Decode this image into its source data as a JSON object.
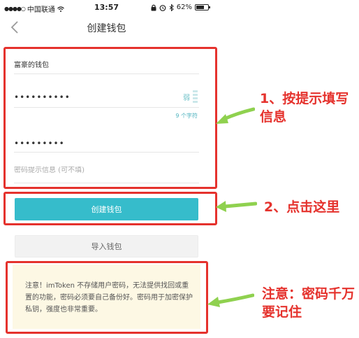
{
  "status_bar": {
    "carrier": "中国联通",
    "time": "13:57",
    "battery": "62%"
  },
  "nav": {
    "title": "创建钱包"
  },
  "form": {
    "wallet_name_value": "富豪的钱包",
    "password_value": "••••••••••",
    "strength_label": "弱",
    "char_count": "9 个字符",
    "confirm_value": "•••••••••",
    "hint_placeholder": "密码提示信息 (可不填)"
  },
  "buttons": {
    "create": "创建钱包",
    "import": "导入钱包"
  },
  "notice": {
    "text": "注意！imToken 不存储用户密码，无法提供找回或重置的功能，密码必须要自己备份好。密码用于加密保护私钥，强度也非常重要。"
  },
  "annotations": {
    "step1": "1、按提示填写信息",
    "step2": "2、点击这里",
    "step3": "注意：密码千万要记住"
  },
  "colors": {
    "accent": "#36bccb",
    "annotation_red": "#e5322d",
    "arrow_green": "#8fd14f",
    "notice_bg": "#fdf8e4"
  },
  "icons": {
    "back": "chevron-left-icon",
    "wifi": "wifi-icon",
    "lock": "lock-icon",
    "alarm": "alarm-icon",
    "bluetooth": "bluetooth-icon",
    "battery": "battery-icon",
    "strength": "strength-bars-icon"
  }
}
